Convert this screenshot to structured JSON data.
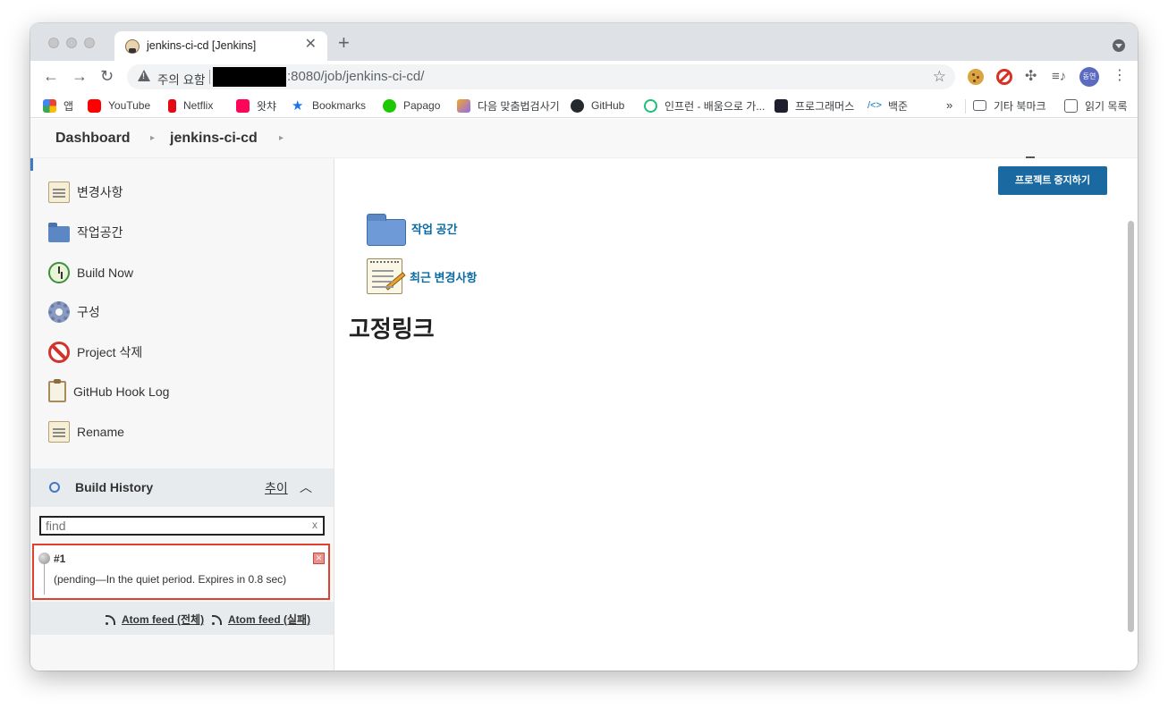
{
  "browser": {
    "tab_title": "jenkins-ci-cd [Jenkins]",
    "tab_close": "✕",
    "new_tab": "+",
    "security_label": "주의 요함",
    "url_visible": ":8080/job/jenkins-ci-cd/",
    "profile_initials": "동연",
    "nav_icons": [
      "back-arrow-icon",
      "forward-arrow-icon",
      "reload-icon"
    ],
    "bookmarks": [
      {
        "label": "앱",
        "icon": "apps-grid-icon",
        "color": "#ea4335"
      },
      {
        "label": "YouTube",
        "icon": "youtube-icon",
        "color": "#ff0000"
      },
      {
        "label": "Netflix",
        "icon": "netflix-icon",
        "color": "#e50914"
      },
      {
        "label": "왓챠",
        "icon": "watcha-icon",
        "color": "#ff0558"
      },
      {
        "label": "Bookmarks",
        "icon": "star-icon",
        "color": "#1a73e8"
      },
      {
        "label": "Papago",
        "icon": "papago-icon",
        "color": "#1ec800"
      },
      {
        "label": "다음 맞춤법검사기",
        "icon": "daum-icon",
        "color": "#8e6cf0"
      },
      {
        "label": "GitHub",
        "icon": "github-icon",
        "color": "#24292e"
      },
      {
        "label": "인프런 - 배움으로 가...",
        "icon": "inflearn-icon",
        "color": "#1dc078"
      },
      {
        "label": "프로그래머스",
        "icon": "programmers-icon",
        "color": "#1e1e2f"
      },
      {
        "label": "백준",
        "icon": "code-brackets-icon",
        "color": "#0076c0"
      }
    ],
    "bookmarks_more": "»",
    "other_bookmarks": "기타 북마크",
    "reading_list": "읽기 목록"
  },
  "breadcrumb": {
    "items": [
      "Dashboard",
      "jenkins-ci-cd"
    ]
  },
  "sidebar": {
    "items": [
      {
        "label": "변경사항",
        "icon": "notepad-icon"
      },
      {
        "label": "작업공간",
        "icon": "folder-icon"
      },
      {
        "label": "Build Now",
        "icon": "clock-icon"
      },
      {
        "label": "구성",
        "icon": "gear-icon"
      },
      {
        "label": "Project 삭제",
        "icon": "no-sign-icon"
      },
      {
        "label": "GitHub Hook Log",
        "icon": "clipboard-icon"
      },
      {
        "label": "Rename",
        "icon": "notepad-icon"
      }
    ],
    "build_history": {
      "title": "Build History",
      "trend": "추이",
      "find_placeholder": "find",
      "find_clear": "x",
      "builds": [
        {
          "number": "#1",
          "status": "(pending—In the quiet period. Expires in 0.8 sec)"
        }
      ],
      "atom_all": "Atom feed (전체)",
      "atom_failed": "Atom feed (실패)"
    }
  },
  "main": {
    "stop_project": "프로젝트 중지하기",
    "links": [
      {
        "label": "작업 공간",
        "icon": "folder-icon"
      },
      {
        "label": "최근 변경사항",
        "icon": "notepad-pencil-icon"
      }
    ],
    "permalinks_title": "고정링크"
  },
  "colors": {
    "jenkins_blue": "#1a6aa1",
    "link_blue": "#0b6aa2",
    "highlight_red": "#e0412f"
  }
}
